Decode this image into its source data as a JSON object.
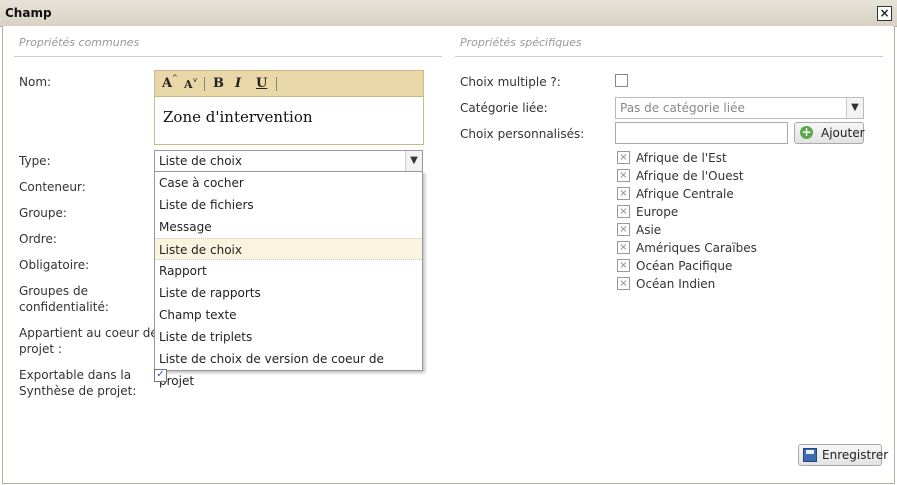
{
  "window": {
    "title": "Champ"
  },
  "common": {
    "section_title": "Propriétés communes",
    "labels": {
      "nom": "Nom:",
      "type": "Type:",
      "conteneur": "Conteneur:",
      "groupe": "Groupe:",
      "ordre": "Ordre:",
      "obligatoire": "Obligatoire:",
      "groupes_conf_1": "Groupes de",
      "groupes_conf_2": "confidentialité:",
      "appartient_1": "Appartient au coeur de",
      "appartient_2": "projet :",
      "exportable_1": "Exportable dans la",
      "exportable_2": "Synthèse de projet:"
    },
    "editor": {
      "toolbar": {
        "font_larger": "A",
        "font_smaller": "A",
        "bold": "B",
        "italic": "I",
        "underline": "U"
      },
      "content": "Zone d'intervention"
    },
    "type_select": {
      "value": "Liste de choix",
      "options": [
        "Case à cocher",
        "Liste de fichiers",
        "Message",
        "Liste de choix",
        "Rapport",
        "Liste de rapports",
        "Champ texte",
        "Liste de triplets",
        "Liste de choix de version de coeur de projet"
      ],
      "selected_index": 3
    },
    "exportable_checked": true
  },
  "specific": {
    "section_title": "Propriétés spécifiques",
    "labels": {
      "choix_multiple": "Choix multiple ?:",
      "categorie": "Catégorie liée:",
      "choix_perso": "Choix personnalisés:"
    },
    "categorie_select": {
      "value": "Pas de catégorie liée"
    },
    "add_button": "Ajouter",
    "choices": [
      "Afrique de l'Est",
      "Afrique de l'Ouest",
      "Afrique Centrale",
      "Europe",
      "Asie",
      "Amériques Caraïbes",
      "Océan Pacifique",
      "Océan Indien"
    ]
  },
  "footer": {
    "save_button": "Enregistrer"
  }
}
